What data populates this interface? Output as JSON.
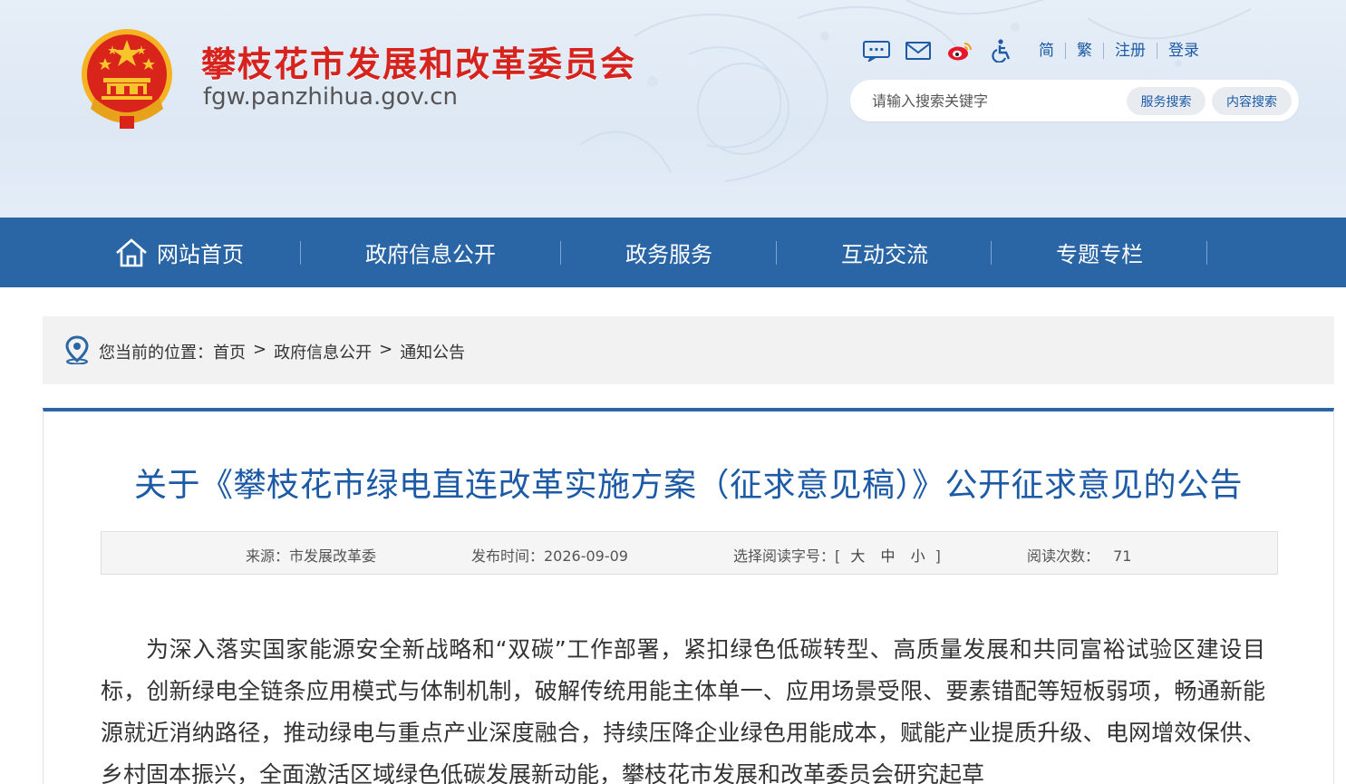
{
  "header": {
    "site_title": "攀枝花市发展和改革委员会",
    "site_domain": "fgw.panzhihua.gov.cn",
    "tools": {
      "icons": [
        "message-icon",
        "mail-icon",
        "weibo-icon",
        "accessibility-icon"
      ],
      "simplified": "简",
      "traditional": "繁",
      "register": "注册",
      "login": "登录"
    },
    "search": {
      "placeholder": "请输入搜索关键字",
      "service_search": "服务搜索",
      "content_search": "内容搜索"
    }
  },
  "nav": {
    "items": [
      "网站首页",
      "政府信息公开",
      "政务服务",
      "互动交流",
      "专题专栏"
    ]
  },
  "breadcrumb": {
    "label": "您当前的位置：",
    "items": [
      "首页",
      "政府信息公开",
      "通知公告"
    ],
    "separator": ">"
  },
  "article": {
    "title": "关于《攀枝花市绿电直连改革实施方案（征求意见稿）》公开征求意见的公告",
    "meta": {
      "source": "来源：市发展改革委",
      "publish_time": "发布时间：2026-09-09",
      "font_size_label": "选择阅读字号：[",
      "font_large": "大",
      "font_medium": "中",
      "font_small": "小",
      "font_close": "]",
      "read_count_label": "阅读次数：",
      "read_count": "71"
    },
    "body": "为深入落实国家能源安全新战略和“双碳”工作部署，紧扣绿色低碳转型、高质量发展和共同富裕试验区建设目标，创新绿电全链条应用模式与体制机制，破解传统用能主体单一、应用场景受限、要素错配等短板弱项，畅通新能源就近消纳路径，推动绿电与重点产业深度融合，持续压降企业绿色用能成本，赋能产业提质升级、电网增效保供、乡村固本振兴，全面激活区域绿色低碳发展新动能，攀枝花市发展和改革委员会研究起草"
  },
  "colors": {
    "nav_blue": "#2a65a6",
    "title_red": "#d6231e",
    "link_blue": "#1c5aa6"
  }
}
